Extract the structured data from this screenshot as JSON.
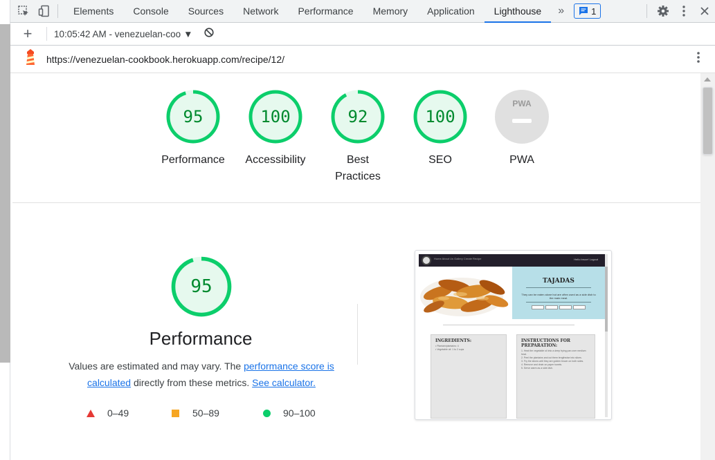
{
  "devtools": {
    "tabs": [
      "Elements",
      "Console",
      "Sources",
      "Network",
      "Performance",
      "Memory",
      "Application",
      "Lighthouse"
    ],
    "active_tab": "Lighthouse",
    "more_label": "»",
    "issues_count": "1"
  },
  "report_bar": {
    "add_label": "+",
    "report_selector": "10:05:42 AM - venezuelan-coo"
  },
  "url": "https://venezuelan-cookbook.herokuapp.com/recipe/12/",
  "categories": [
    {
      "score": "95",
      "label": "Performance"
    },
    {
      "score": "100",
      "label": "Accessibility"
    },
    {
      "score": "92",
      "label": "Best Practices"
    },
    {
      "score": "100",
      "label": "SEO"
    }
  ],
  "pwa": {
    "badge_text": "PWA",
    "label": "PWA"
  },
  "performance": {
    "score": "95",
    "title": "Performance",
    "desc_before": "Values are estimated and may vary. The ",
    "link_score": "performance score is calculated",
    "desc_middle": " directly from these metrics. ",
    "link_calc": "See calculator.",
    "legend": [
      {
        "range": "0–49",
        "color": "#e53935"
      },
      {
        "range": "50–89",
        "color": "#f6a623"
      },
      {
        "range": "90–100",
        "color": "#0cce6b"
      }
    ]
  },
  "thumbnail": {
    "nav_links": "Home   About Us   Gallery   Create Recipe",
    "nav_right": "Hello bruce!      Logout",
    "recipe_title": "TAJADAS",
    "recipe_subtitle": "They can be eaten alone but are often used as a side dish to the main meal.",
    "ingredients_heading": "INGREDIENTS:",
    "ingredients_lines": [
      "• Plantain/plantains: 4",
      "• Vegetable oil: 1 to 2 cups"
    ],
    "instructions_heading": "INSTRUCTIONS FOR PREPARATION:",
    "instructions_lines": [
      "1. Heat the vegetable oil into a deep frying pan over medium heat.",
      "2. Peel the plantains and cut them lengthwise into slices.",
      "3. Fry the slices until they are golden brown on both sides.",
      "4. Remove and drain on paper towels.",
      "5. Serve warm as a side dish."
    ]
  },
  "colors": {
    "pass_green": "#0cce6b",
    "pass_text": "#008a2e",
    "pass_fill": "#e6f9ee",
    "accent_blue": "#1a73e8"
  }
}
